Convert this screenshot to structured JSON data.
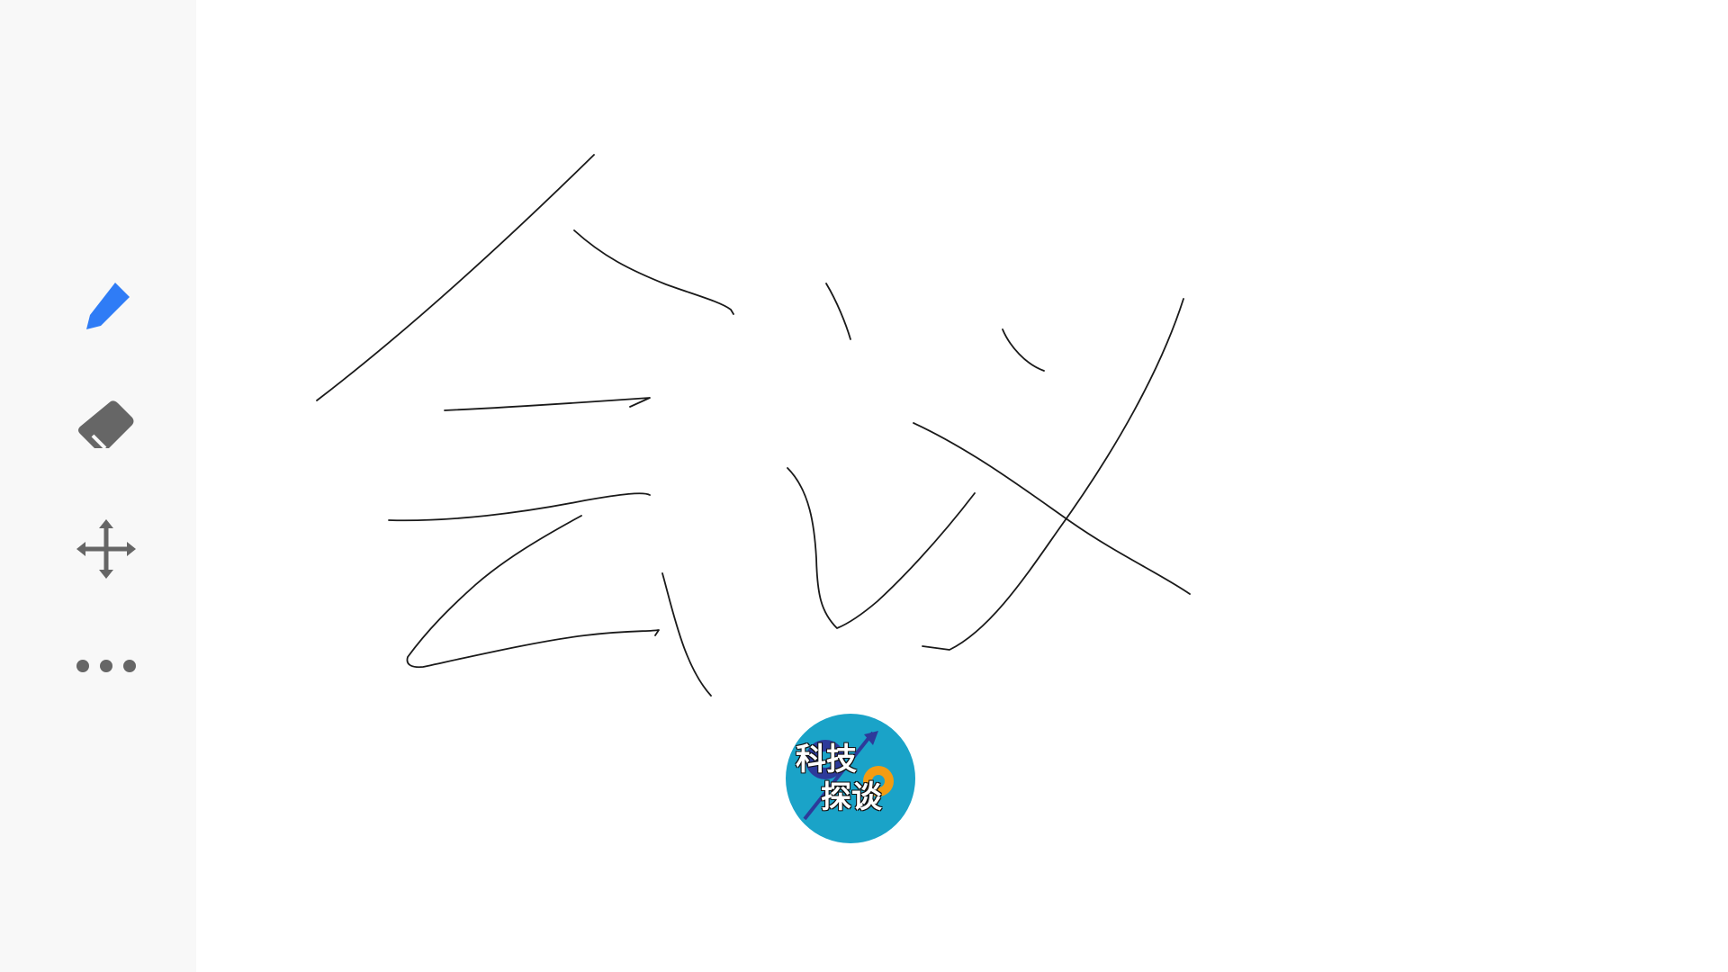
{
  "toolbar": {
    "tools": [
      {
        "name": "pen",
        "icon": "pencil-icon",
        "active": true,
        "color": "#2f7cf6"
      },
      {
        "name": "eraser",
        "icon": "eraser-icon",
        "active": false,
        "color": "#666666"
      },
      {
        "name": "move",
        "icon": "move-arrows-icon",
        "active": false,
        "color": "#666666"
      },
      {
        "name": "more",
        "icon": "more-dots-icon",
        "active": false,
        "color": "#666666"
      }
    ]
  },
  "canvas": {
    "background": "#ffffff",
    "ink_color": "#1a1a1a",
    "handwriting": "会议"
  },
  "watermark": {
    "line1": "科技",
    "line2": "探谈",
    "background": "#1aa3c8",
    "gear_colors": [
      "#2d3a9a",
      "#f39c12"
    ]
  }
}
